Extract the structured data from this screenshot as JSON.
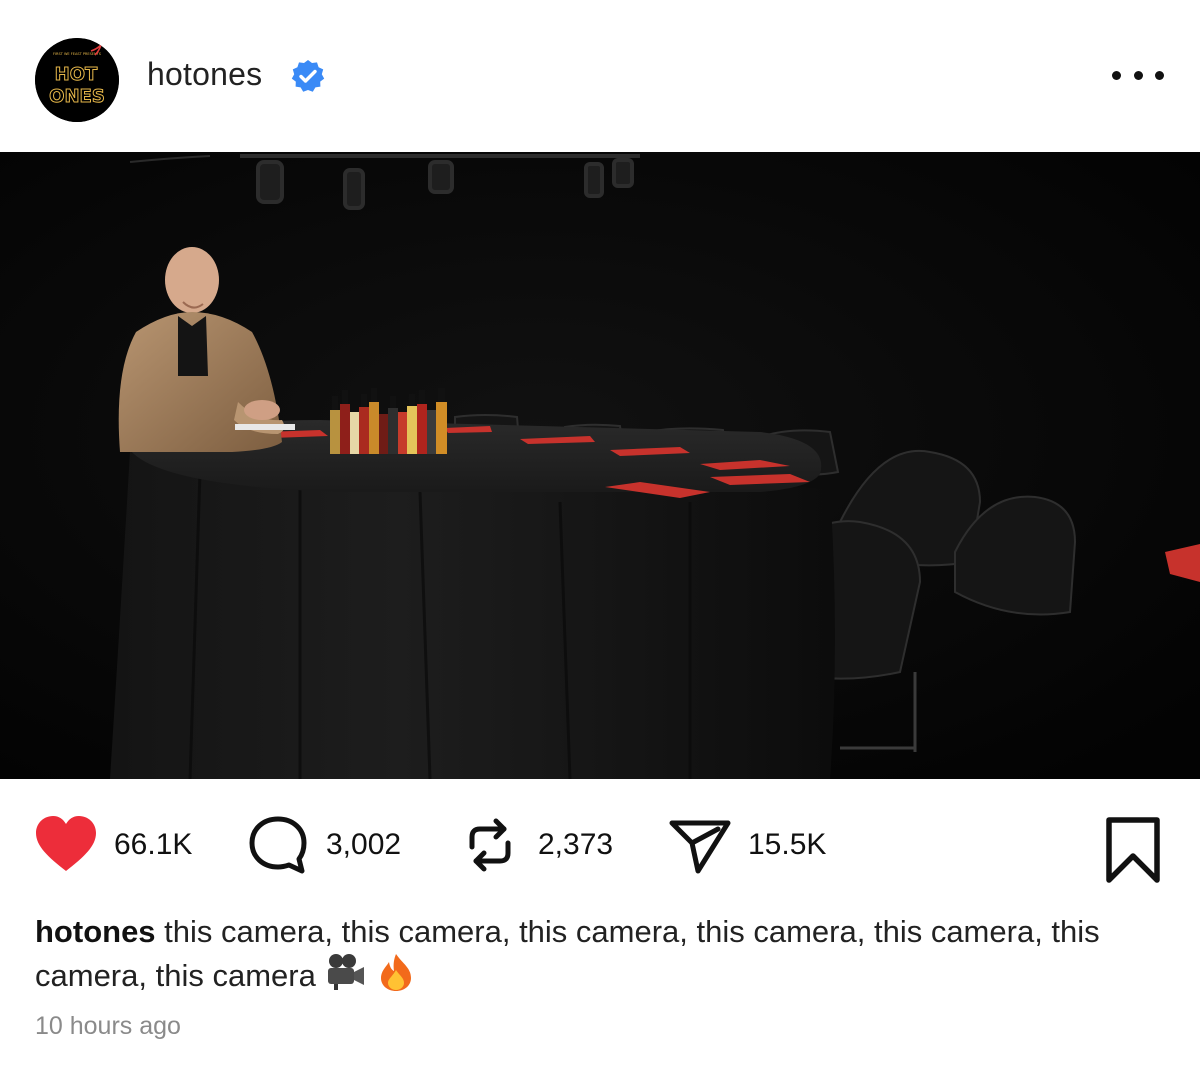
{
  "post": {
    "username": "hotones",
    "verified": true,
    "avatar": {
      "logo_small": "FIRST WE FEAST PRESENTS",
      "logo_line1": "HOT",
      "logo_line2": "ONES"
    },
    "more_icon": "more-horizontal-icon"
  },
  "actions": {
    "likes": "66.1K",
    "comments": "3,002",
    "reposts": "2,373",
    "shares": "15.5K",
    "liked": true
  },
  "caption": {
    "user": "hotones",
    "text": " this camera, this camera, this camera, this camera, this camera, this camera, this camera"
  },
  "timestamp": "10 hours ago",
  "colors": {
    "heart": "#ed2d3a",
    "verified": "#3a8af6",
    "text": "#111111",
    "muted": "#8a8a8a"
  }
}
